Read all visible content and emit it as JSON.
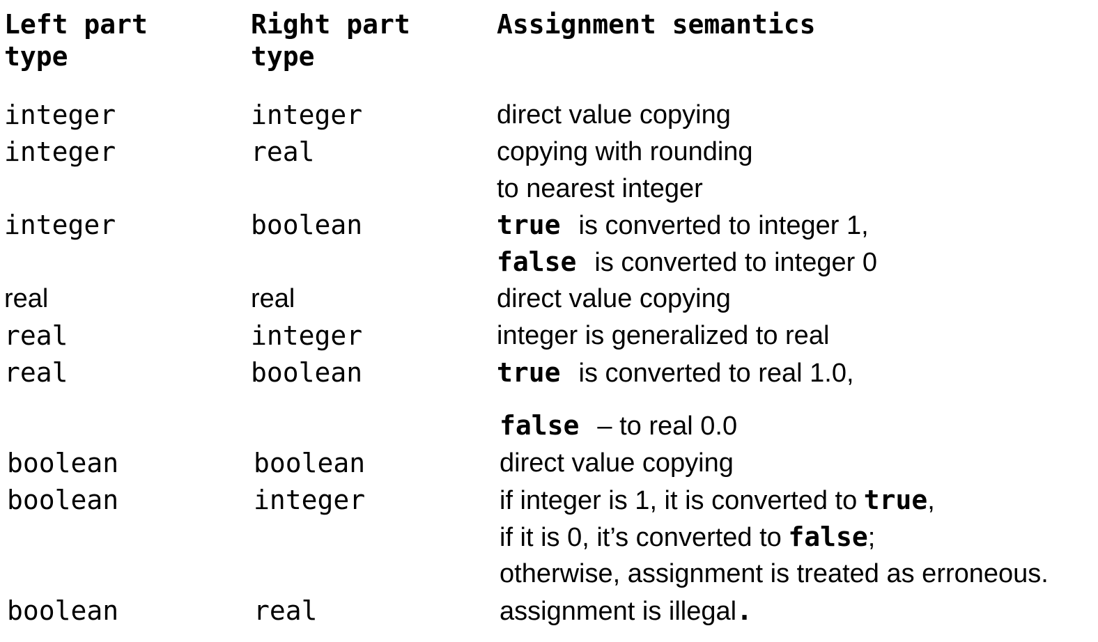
{
  "header": {
    "col1_line1": "Left part",
    "col1_line2": "type",
    "col2_line1": "Right part",
    "col2_line2": "type",
    "col3": "Assignment semantics"
  },
  "rows": [
    {
      "left": "integer",
      "right": "integer",
      "semantics": [
        "direct value copying"
      ]
    },
    {
      "left": "integer",
      "right": "real",
      "semantics": [
        "copying with rounding",
        "to nearest integer"
      ]
    },
    {
      "left": "integer",
      "right": "boolean",
      "semantics_line1_kw": "true",
      "semantics_line1_text": "is converted to integer 1,",
      "semantics_line2_kw": "false",
      "semantics_line2_text": "is converted to integer 0"
    },
    {
      "left": "real",
      "right": "real",
      "semantics": [
        "direct value copying"
      ]
    },
    {
      "left": "real",
      "right": "integer",
      "semantics": [
        "integer is generalized to real"
      ]
    },
    {
      "left": "real",
      "right": "boolean",
      "semantics_line1_kw": "true",
      "semantics_line1_text": "is converted to real 1.0,",
      "semantics_line2_kw": "false",
      "semantics_line2_text": "– to real 0.0"
    },
    {
      "left": "boolean",
      "right": "boolean",
      "semantics": [
        "direct value copying"
      ]
    },
    {
      "left": "boolean",
      "right": "integer",
      "semantics_line1_text": "if integer is 1, it is converted to",
      "semantics_line1_kw": "true",
      "semantics_line1_tail": ",",
      "semantics_line2_text": "if it is 0, it’s converted to",
      "semantics_line2_kw": "false",
      "semantics_line2_tail": ";",
      "semantics_line3_text": "otherwise, assignment is treated as erroneous."
    },
    {
      "left": "boolean",
      "right": "real",
      "semantics_text": "assignment is illegal",
      "semantics_tail": "."
    }
  ]
}
